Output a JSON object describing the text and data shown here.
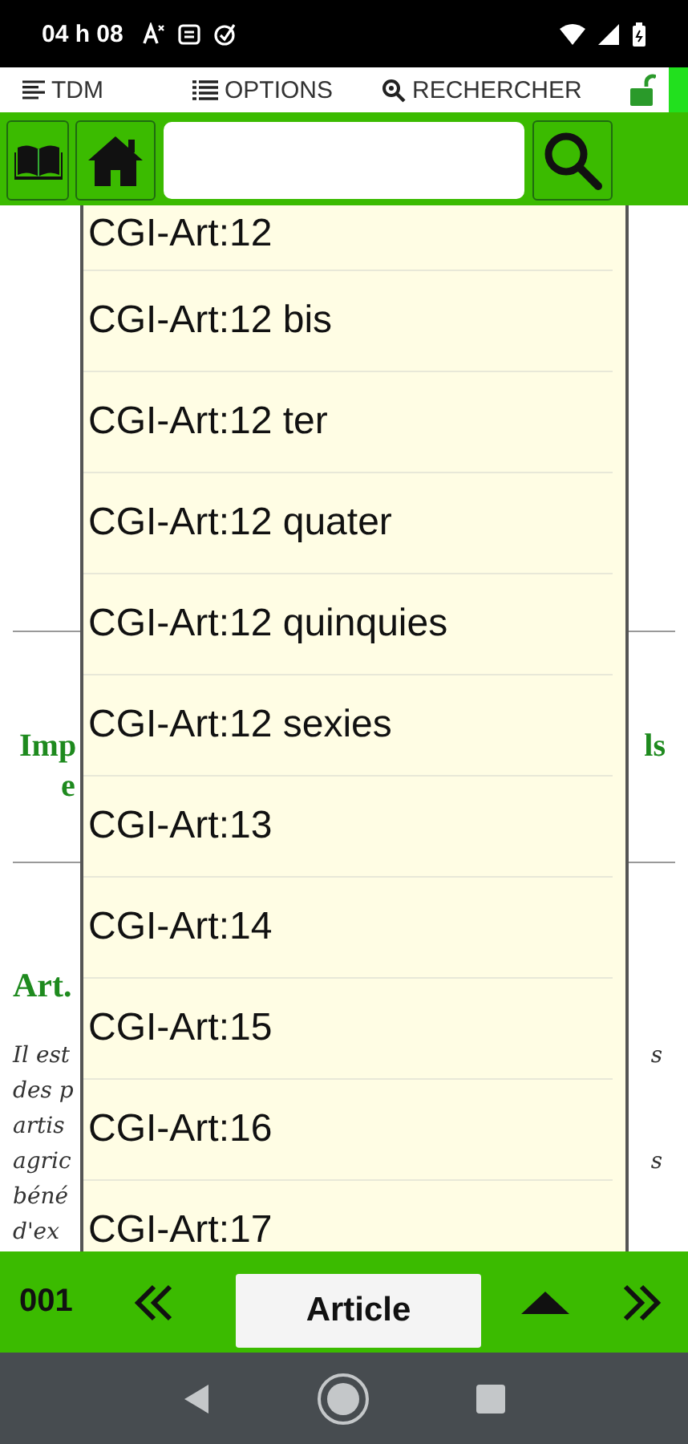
{
  "status_bar": {
    "time": "04 h 08"
  },
  "menu_bar": {
    "items": [
      {
        "kind": "toc",
        "label": "TDM"
      },
      {
        "kind": "options",
        "label": "OPTIONS"
      },
      {
        "kind": "search",
        "label": "RECHERCHER"
      }
    ],
    "locked": false
  },
  "background": {
    "heading_lines": [
      {
        "left": "Imp",
        "right": "ls"
      },
      {
        "left": "e"
      }
    ],
    "section_title": "Art.",
    "paragraph_lines": [
      {
        "left": "Il est",
        "right": "s"
      },
      {
        "left": "des p"
      },
      {
        "left": "artis"
      },
      {
        "left": "agric",
        "right": "s"
      },
      {
        "left": "béné"
      },
      {
        "left": "d'ex"
      }
    ]
  },
  "dropdown": {
    "items": [
      "CGI-Art:12",
      "CGI-Art:12 bis",
      "CGI-Art:12 ter",
      "CGI-Art:12 quater",
      "CGI-Art:12 quinquies",
      "CGI-Art:12 sexies",
      "CGI-Art:13",
      "CGI-Art:14",
      "CGI-Art:15",
      "CGI-Art:16",
      "CGI-Art:17"
    ]
  },
  "bottom_bar": {
    "page": "001",
    "tab_label": "Article"
  }
}
